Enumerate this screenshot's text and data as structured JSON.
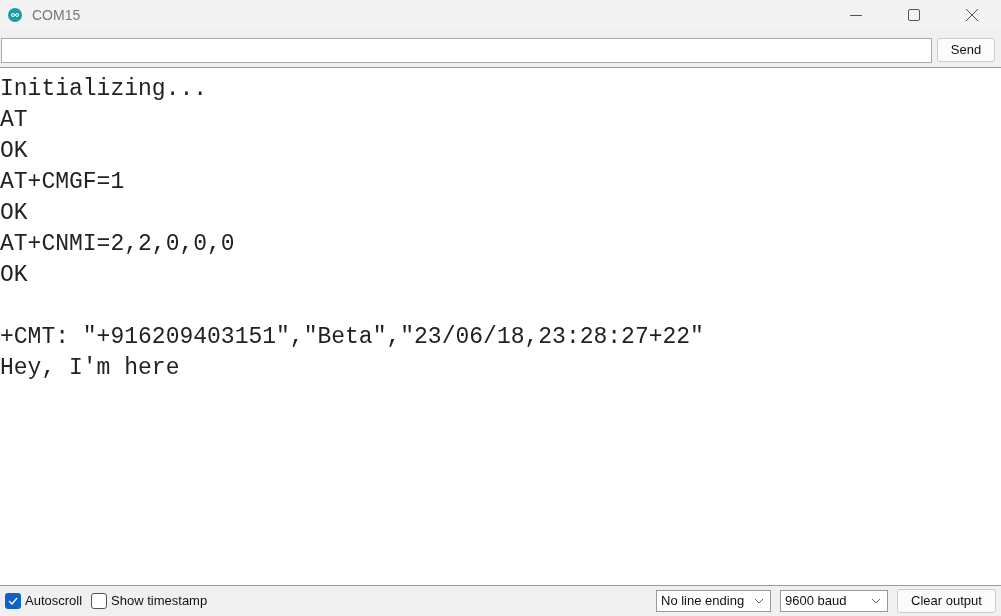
{
  "window": {
    "title": "COM15"
  },
  "send_button": "Send",
  "output_blocks": [
    [
      "Initializing...",
      "AT",
      "OK",
      "AT+CMGF=1",
      "OK",
      "AT+CNMI=2,2,0,0,0",
      "OK"
    ],
    [
      "+CMT: \"+916209403151\",\"Beta\",\"23/06/18,23:28:27+22\"",
      "Hey, I'm here"
    ]
  ],
  "options": [
    {
      "label": "Autoscroll",
      "checked": true
    },
    {
      "label": "Show timestamp",
      "checked": false
    }
  ],
  "line_ending": "No line ending",
  "baud": "9600 baud",
  "clear_button": "Clear output"
}
